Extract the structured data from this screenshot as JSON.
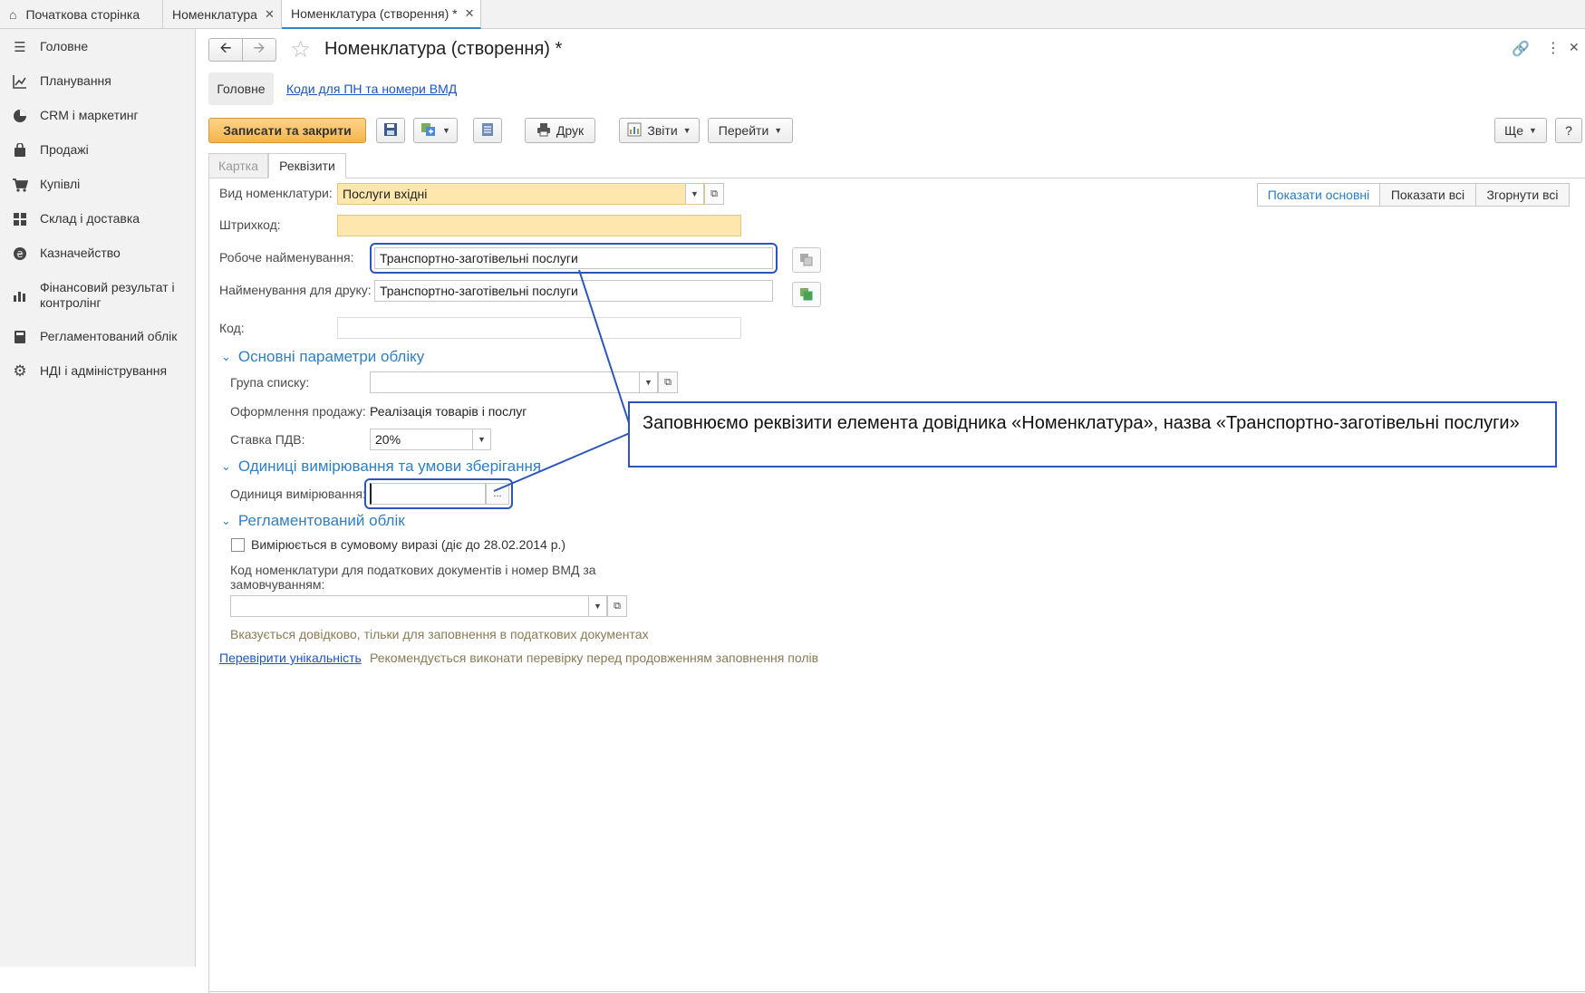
{
  "tabs": [
    {
      "label": "Початкова сторінка"
    },
    {
      "label": "Номенклатура"
    },
    {
      "label": "Номенклатура (створення) *"
    }
  ],
  "sidebar": {
    "items": [
      {
        "label": "Головне"
      },
      {
        "label": "Планування"
      },
      {
        "label": "CRM і маркетинг"
      },
      {
        "label": "Продажі"
      },
      {
        "label": "Купівлі"
      },
      {
        "label": "Склад і доставка"
      },
      {
        "label": "Казначейство"
      },
      {
        "label": "Фінансовий результат і контролінг"
      },
      {
        "label": "Регламентований облік"
      },
      {
        "label": "НДІ і адміністрування"
      }
    ]
  },
  "header": {
    "title": "Номенклатура (створення) *",
    "nav_main": "Головне",
    "nav_codes": "Коди для ПН та номери ВМД"
  },
  "toolbar": {
    "save_close": "Записати та закрити",
    "print": "Друк",
    "reports": "Звіти",
    "goto": "Перейти",
    "more": "Ще",
    "help": "?"
  },
  "subtabs": {
    "card": "Картка",
    "requisites": "Реквізити"
  },
  "view_buttons": {
    "show_main": "Показати основні",
    "show_all": "Показати всі",
    "collapse_all": "Згорнути всі"
  },
  "form": {
    "kind_label": "Вид номенклатури:",
    "kind_value": "Послуги вхідні",
    "barcode_label": "Штрихкод:",
    "barcode_value": "",
    "work_name_label": "Робоче найменування:",
    "work_name_value": "Транспортно-заготівельні послуги",
    "print_name_label": "Найменування для друку:",
    "print_name_value": "Транспортно-заготівельні послуги",
    "code_label": "Код:",
    "code_value": ""
  },
  "section_main": {
    "title": "Основні параметри обліку",
    "group_label": "Група списку:",
    "group_value": "",
    "sale_label": "Оформлення продажу:",
    "sale_value": "Реалізація товарів і послуг",
    "vat_label": "Ставка ПДВ:",
    "vat_value": "20%"
  },
  "section_units": {
    "title": "Одиниці вимірювання та умови зберігання",
    "unit_label": "Одиниця вимірювання:",
    "unit_value": "",
    "unit_btn": "..."
  },
  "section_reg": {
    "title": "Регламентований облік",
    "checkbox_label": "Вимірюється в сумовому виразі (діє до 28.02.2014 р.)",
    "code_label_1": "Код номенклатури для податкових документів і номер ВМД за",
    "code_label_2": "замовчуванням:",
    "code_value": "",
    "note": "Вказується довідково, тільки для заповнення в податкових документах"
  },
  "uniqueness": {
    "link": "Перевірити унікальність",
    "note": "Рекомендується виконати перевірку перед продовженням заповнення полів"
  },
  "callout": {
    "text": "Заповнюємо реквізити елемента довідника «Номенклатура», назва «Транспортно-заготівельні послуги»"
  },
  "colors": {
    "accent": "#2c88c8",
    "required": "#fde7ad",
    "primary_button": "#f6b44a",
    "callout_border": "#2c57b8"
  }
}
